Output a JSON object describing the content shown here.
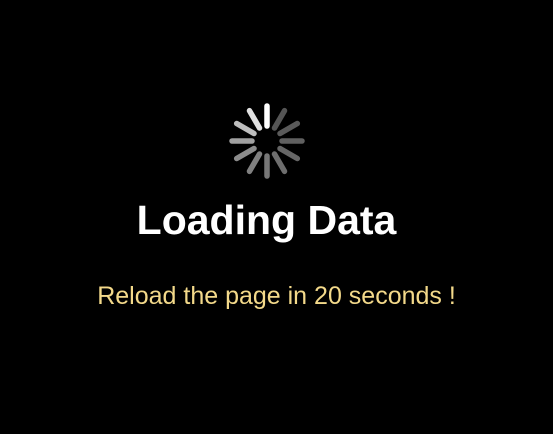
{
  "loading": {
    "title": "Loading Data",
    "message": "Reload the page in 20 seconds !",
    "spinner_icon": "spinner-icon"
  },
  "colors": {
    "background": "#000000",
    "title": "#ffffff",
    "message": "#f3d98a",
    "spinner_head": "#ffffff",
    "spinner_tail": "#4a4a4a"
  }
}
